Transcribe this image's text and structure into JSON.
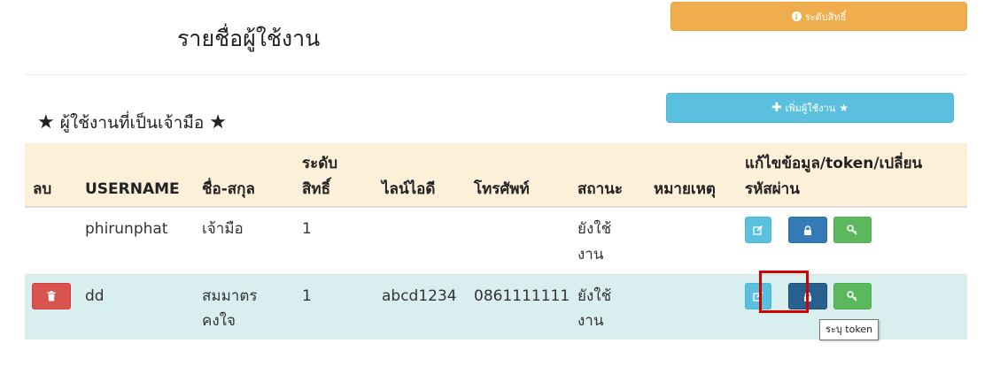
{
  "header": {
    "title": "รายชื่อผู้ใช้งาน",
    "level_button": "ระดับสิทธิ์"
  },
  "section": {
    "title": "ผู้ใช้งานที่เป็นเจ้ามือ",
    "add_button": "เพิ่มผู้ใช้งาน"
  },
  "table": {
    "headers": {
      "delete": "ลบ",
      "username": "USERNAME",
      "name_line1": "ชื่อ-สกุล",
      "level_line1": "ระดับ",
      "level_line2": "สิทธิ์",
      "line_id": "ไลน์ไอดี",
      "phone": "โทรศัพท์",
      "status": "สถานะ",
      "note": "หมายเหตุ",
      "actions_line1": "แก้ไขข้อมูล/token/เปลี่ยน",
      "actions_line2": "รหัสผ่าน"
    },
    "rows": [
      {
        "username": "phirunphat",
        "name_line1": "เจ้ามือ",
        "name_line2": "",
        "level": "1",
        "line_id": "",
        "phone": "",
        "status_line1": "ยังใช้",
        "status_line2": "งาน",
        "note": ""
      },
      {
        "username": "dd",
        "name_line1": "สมมาตร",
        "name_line2": "คงใจ",
        "level": "1",
        "line_id": "abcd1234",
        "phone": "0861111111",
        "status_line1": "ยังใช้",
        "status_line2": "งาน",
        "note": ""
      }
    ]
  },
  "tooltip": {
    "text": "ระบุ token"
  },
  "colors": {
    "warning": "#f0ad4e",
    "info": "#5bc0de",
    "primary": "#337ab7",
    "success": "#5cb85c",
    "danger": "#d9534f",
    "header_bg": "#fcf0d9",
    "row_highlight": "#d9eeee",
    "focus_outline": "#d00000"
  },
  "icons": {
    "level_button": "info-circle-icon",
    "add_button": [
      "plus-icon",
      "star-icon"
    ],
    "section_title": [
      "star-icon",
      "star-icon"
    ],
    "edit": "edit-icon",
    "token": "lock-icon",
    "password": "key-icon",
    "delete": "trash-icon"
  }
}
